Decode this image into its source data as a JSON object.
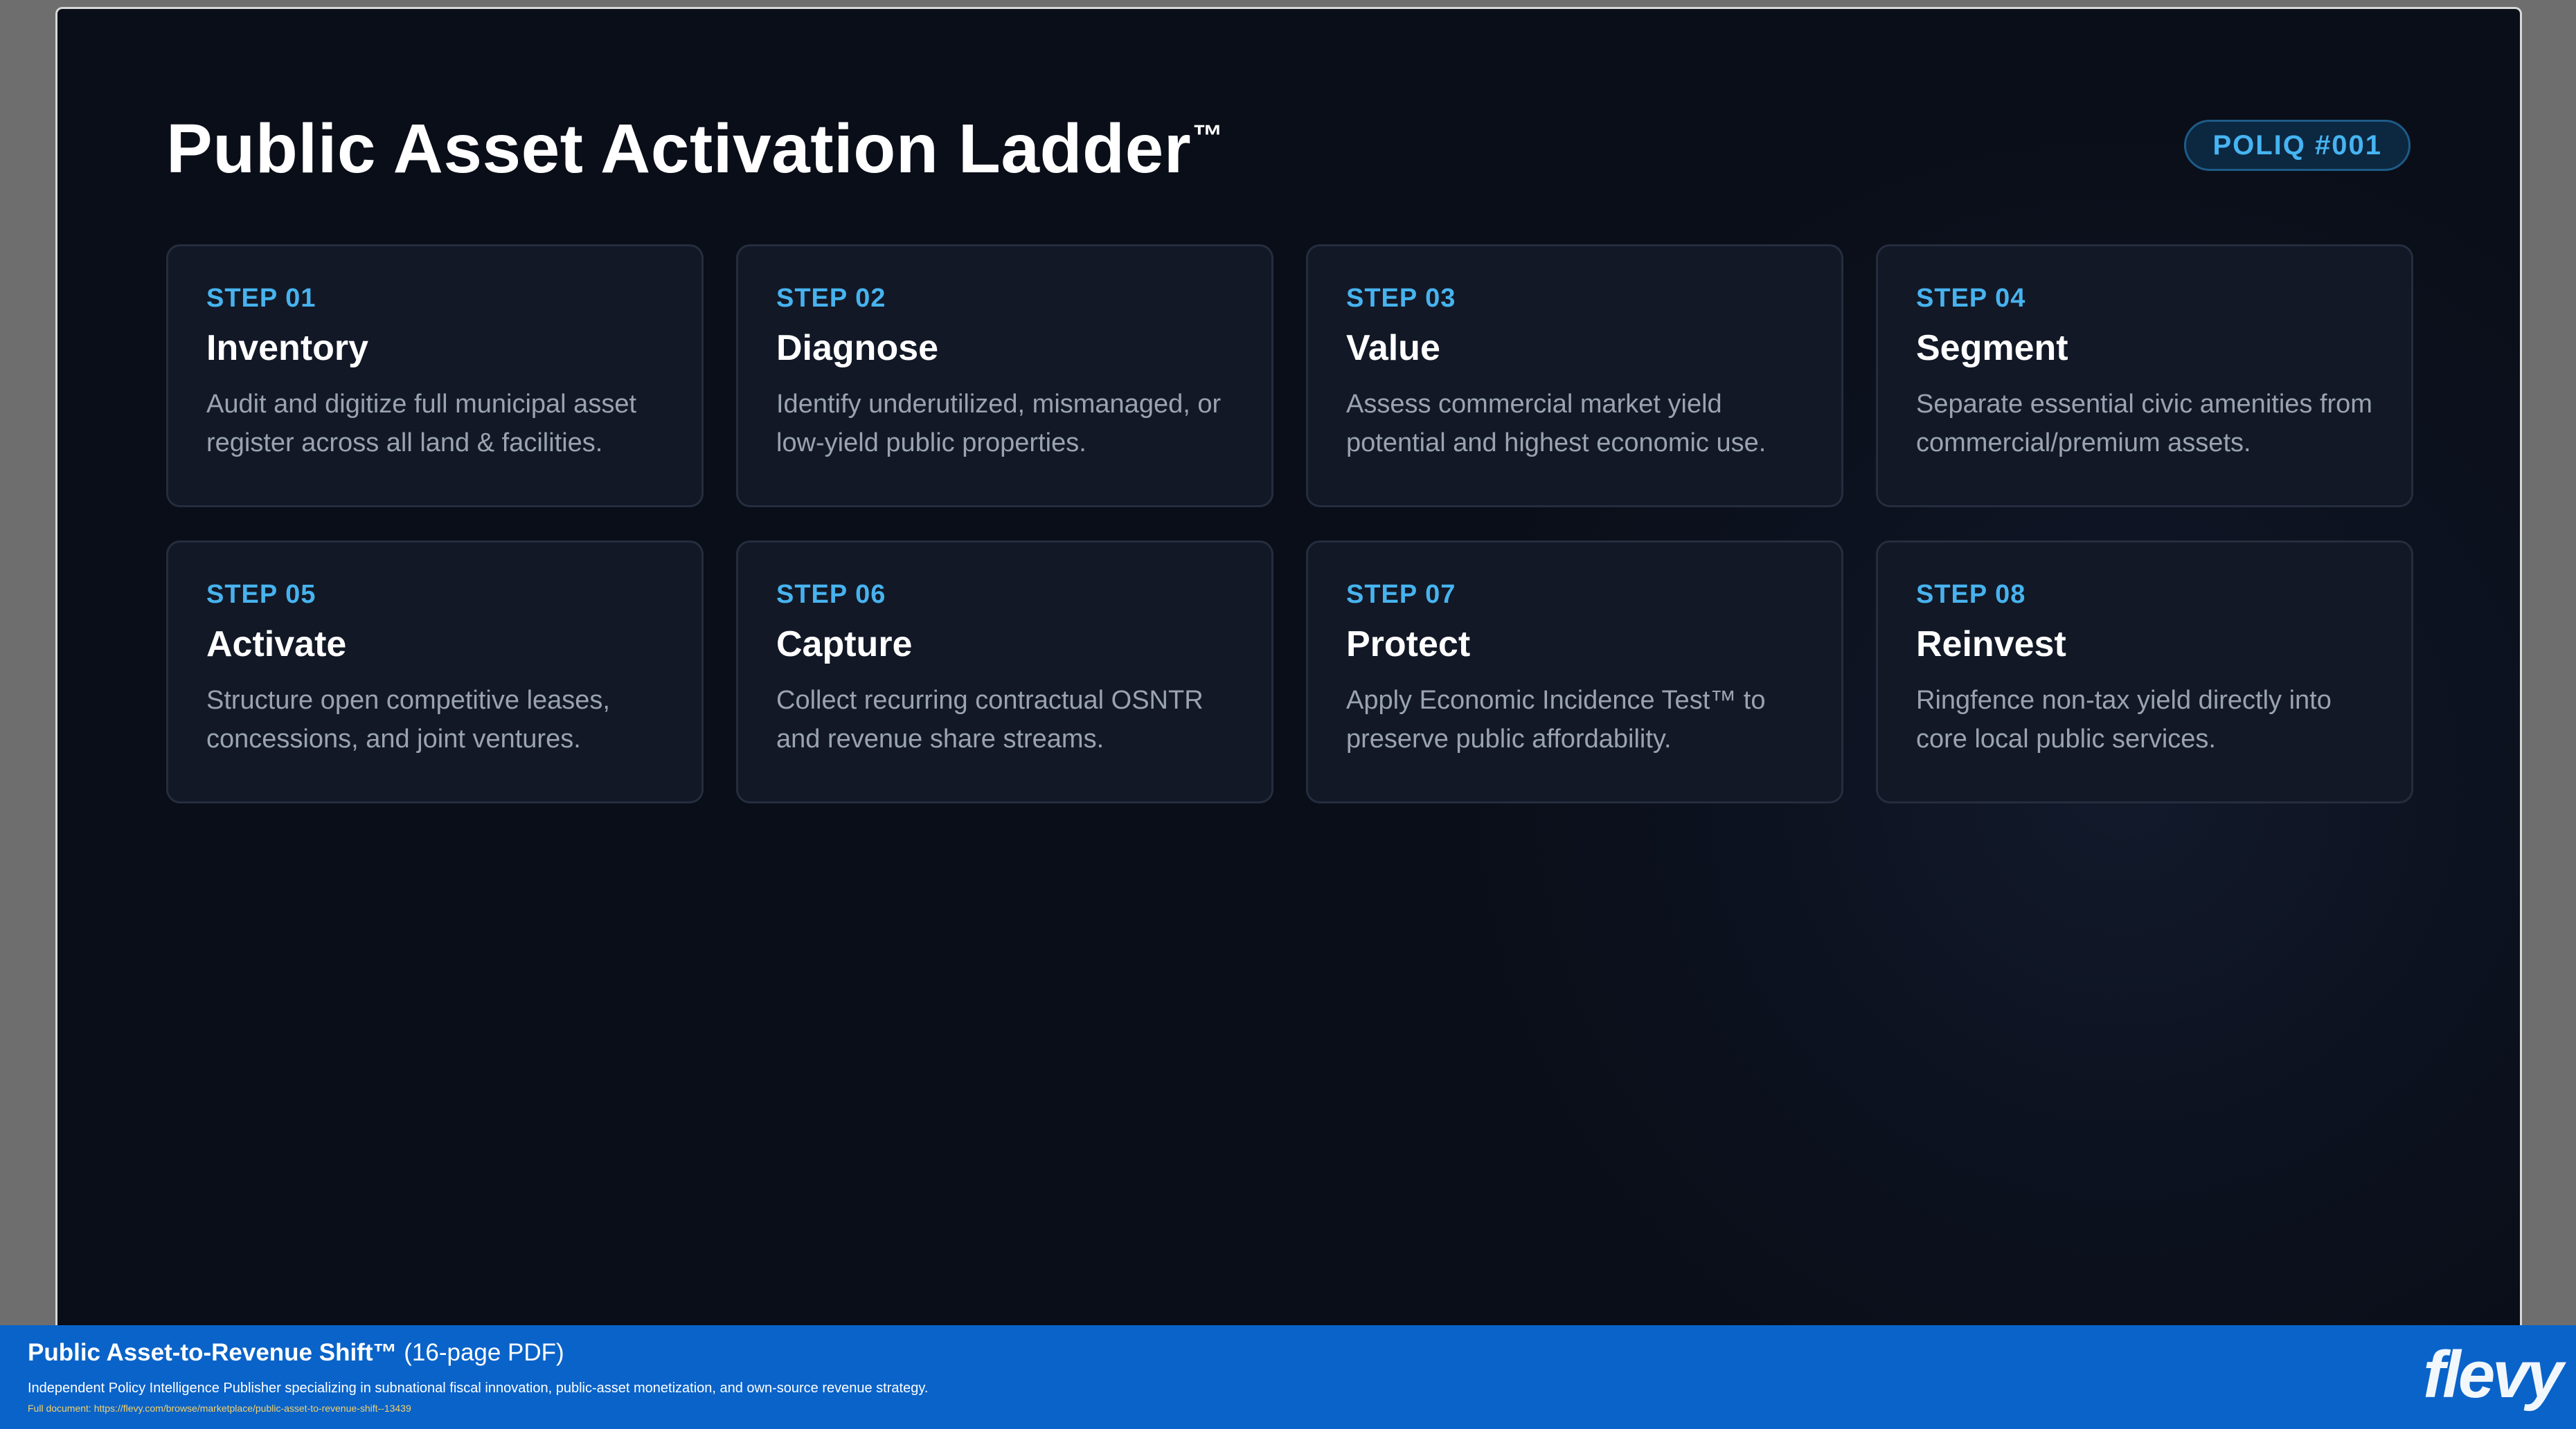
{
  "slide": {
    "title": "Public Asset Activation Ladder",
    "title_mark": "™",
    "badge": "POLIQ #001",
    "steps": [
      {
        "label": "STEP 01",
        "title": "Inventory",
        "description": "Audit and digitize full municipal asset register across all land & facilities."
      },
      {
        "label": "STEP 02",
        "title": "Diagnose",
        "description": "Identify underutilized, mismanaged, or low-yield public properties."
      },
      {
        "label": "STEP 03",
        "title": "Value",
        "description": "Assess commercial market yield potential and highest economic use."
      },
      {
        "label": "STEP 04",
        "title": "Segment",
        "description": "Separate essential civic amenities from commercial/premium assets."
      },
      {
        "label": "STEP 05",
        "title": "Activate",
        "description": "Structure open competitive leases, concessions, and joint ventures."
      },
      {
        "label": "STEP 06",
        "title": "Capture",
        "description": "Collect recurring contractual OSNTR and revenue share streams."
      },
      {
        "label": "STEP 07",
        "title": "Protect",
        "description": "Apply Economic Incidence Test™ to preserve public affordability."
      },
      {
        "label": "STEP 08",
        "title": "Reinvest",
        "description": "Ringfence non-tax yield directly into core local public services."
      }
    ]
  },
  "footer": {
    "doc_title": "Public Asset-to-Revenue Shift™",
    "doc_pages": "(16-page PDF)",
    "description": "Independent Policy Intelligence Publisher specializing in subnational fiscal innovation, public-asset monetization, and own-source revenue strategy.",
    "link": "Full document: https://flevy.com/browse/marketplace/public-asset-to-revenue-shift--13439",
    "logo": "flevy"
  },
  "colors": {
    "background": "#0a0e18",
    "card": "#121826",
    "accent": "#47b3ef",
    "footer": "#0a63c9"
  }
}
